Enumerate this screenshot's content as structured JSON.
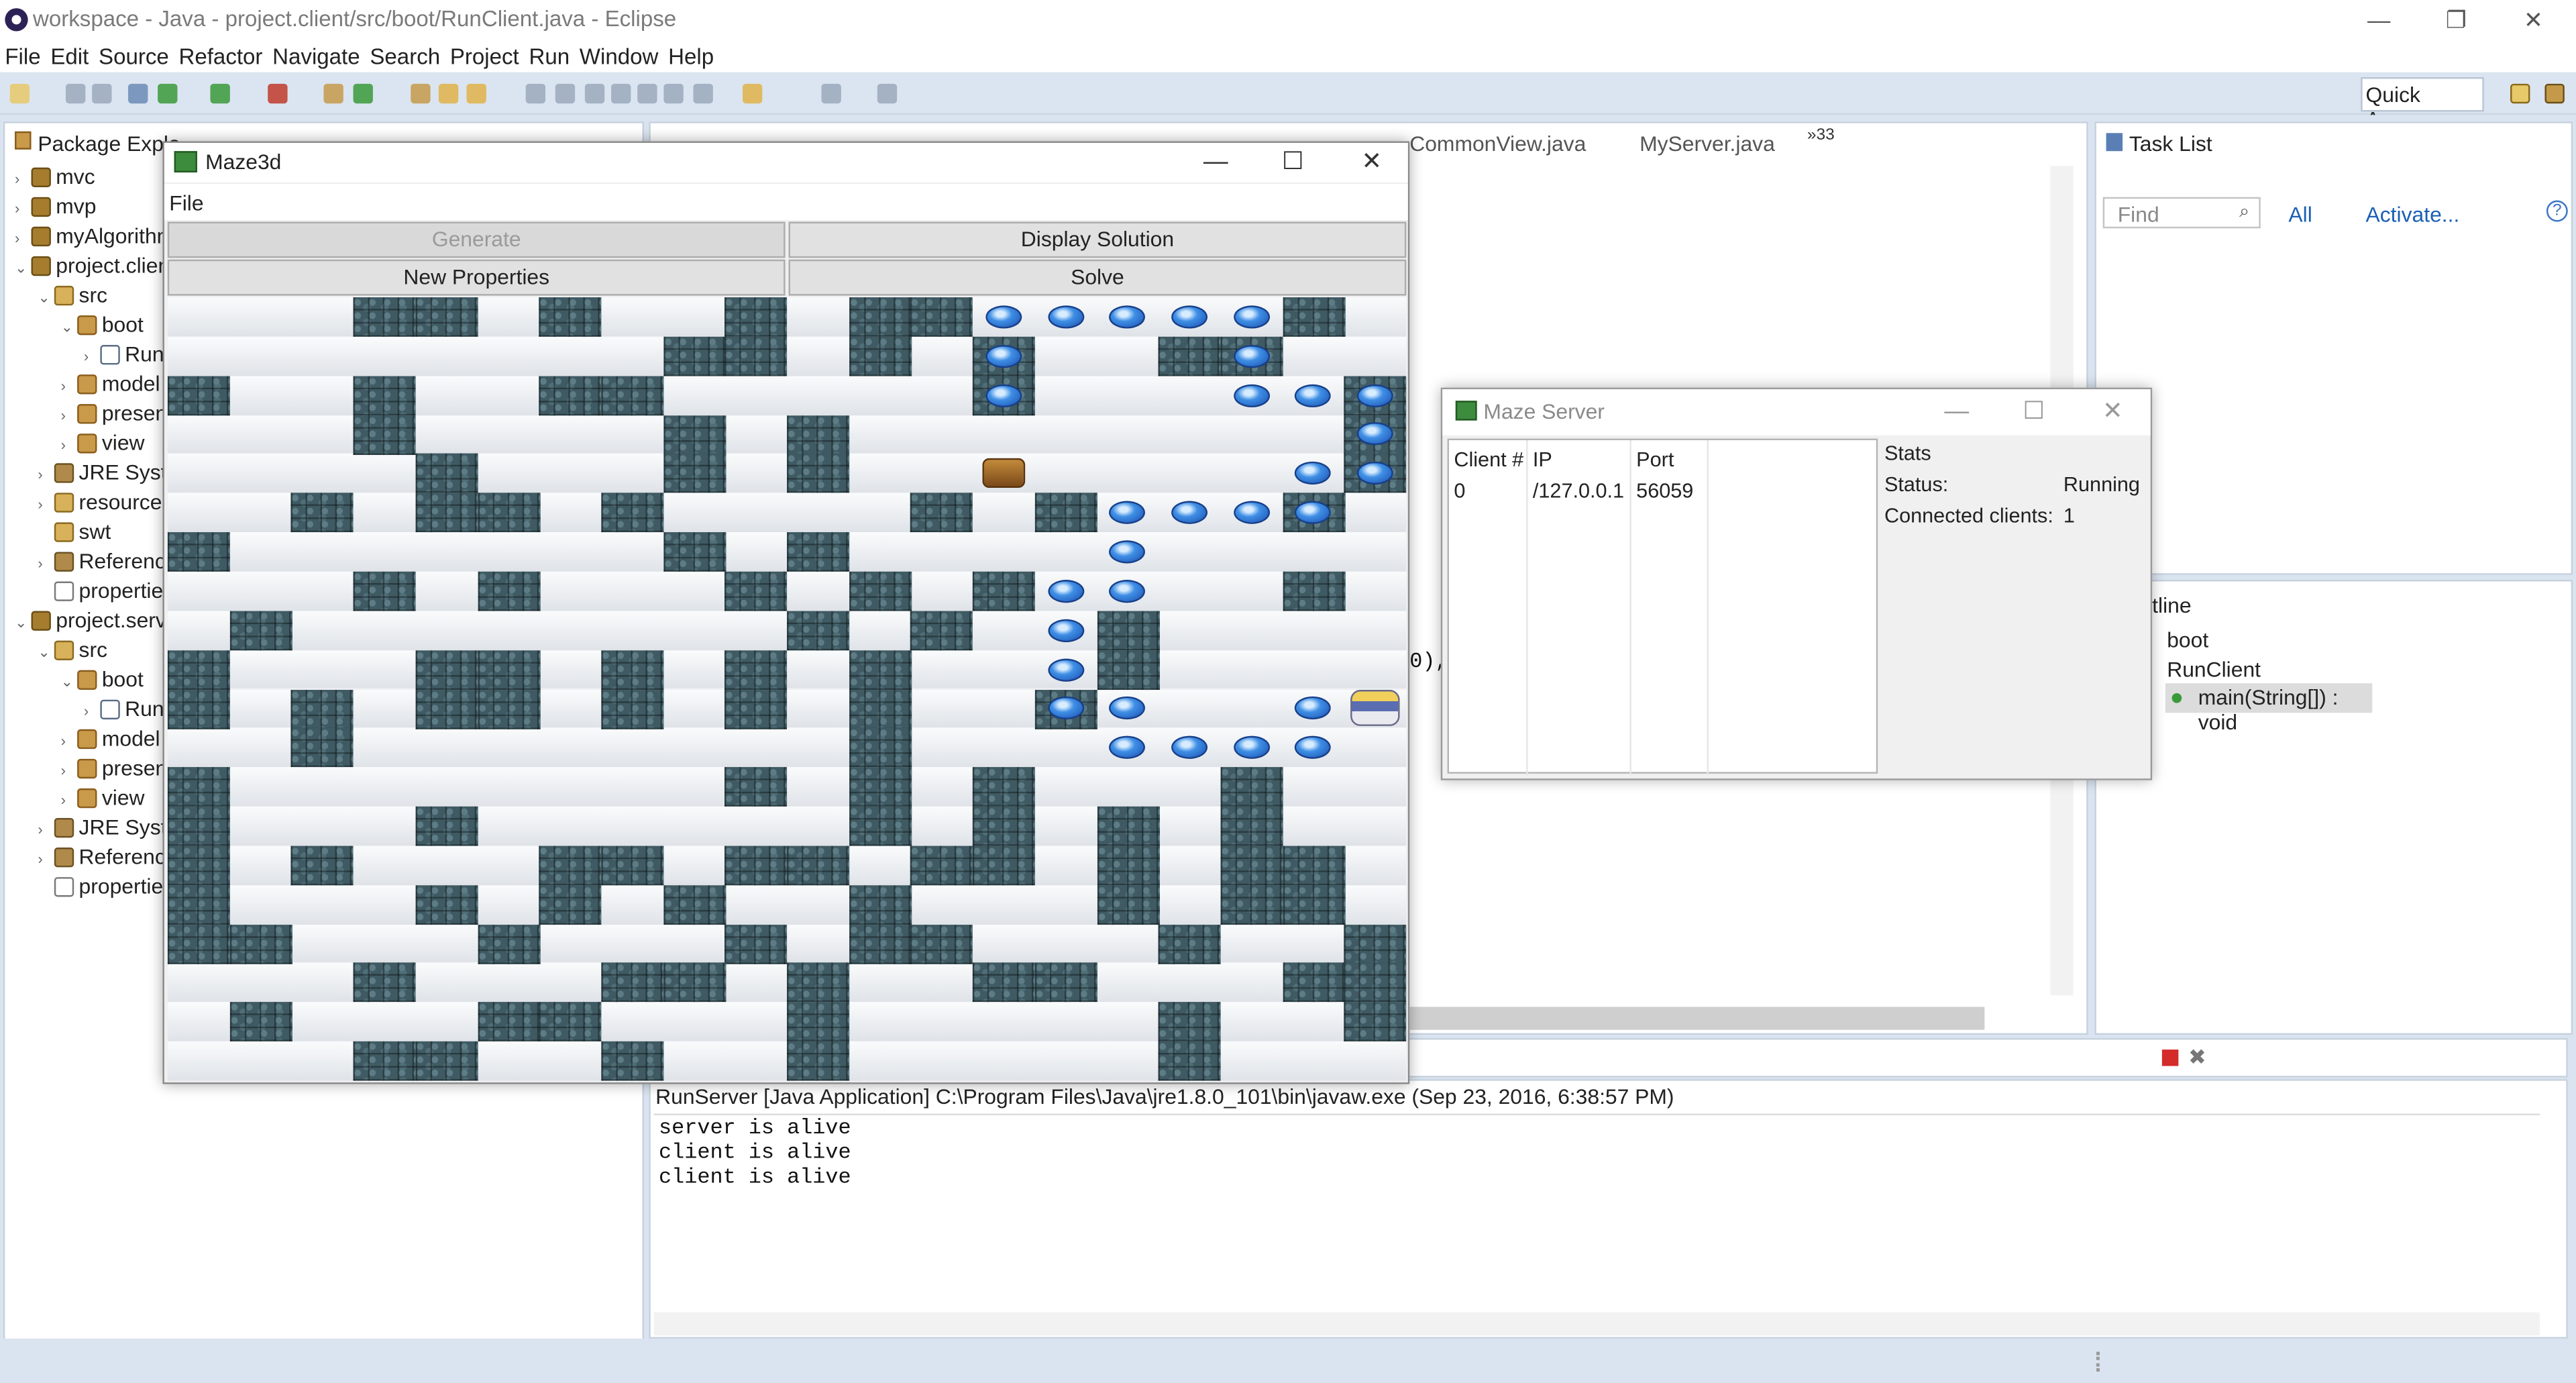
{
  "window": {
    "title": "workspace - Java - project.client/src/boot/RunClient.java - Eclipse",
    "minimize": "—",
    "restore": "❐",
    "close": "✕"
  },
  "menu": [
    "File",
    "Edit",
    "Source",
    "Refactor",
    "Navigate",
    "Search",
    "Project",
    "Run",
    "Window",
    "Help"
  ],
  "toolbar": {
    "quick_access": "Quick Access"
  },
  "package_explorer": {
    "tab": "Package Explo",
    "items": [
      {
        "label": "mvc",
        "icon": "project-icon",
        "indent": 0,
        "twisty": "›"
      },
      {
        "label": "mvp",
        "icon": "project-icon",
        "indent": 0,
        "twisty": "›"
      },
      {
        "label": "myAlgorithm",
        "icon": "project-icon",
        "indent": 0,
        "twisty": "›"
      },
      {
        "label": "project.client",
        "icon": "project-icon",
        "indent": 0,
        "twisty": "⌄"
      },
      {
        "label": "src",
        "icon": "source-folder-icon",
        "indent": 1,
        "twisty": "⌄"
      },
      {
        "label": "boot",
        "icon": "package-icon",
        "indent": 2,
        "twisty": "⌄"
      },
      {
        "label": "RunClient.java",
        "icon": "java-file-icon",
        "indent": 3,
        "twisty": "›"
      },
      {
        "label": "model",
        "icon": "package-icon",
        "indent": 2,
        "twisty": "›"
      },
      {
        "label": "presenter",
        "icon": "package-icon",
        "indent": 2,
        "twisty": "›"
      },
      {
        "label": "view",
        "icon": "package-icon",
        "indent": 2,
        "twisty": "›"
      },
      {
        "label": "JRE System Library",
        "icon": "library-icon",
        "indent": 1,
        "twisty": "›"
      },
      {
        "label": "resources",
        "icon": "source-folder-icon",
        "indent": 1,
        "twisty": "›"
      },
      {
        "label": "swt",
        "icon": "folder-icon",
        "indent": 1,
        "twisty": ""
      },
      {
        "label": "Referenced Libraries",
        "icon": "library-icon",
        "indent": 1,
        "twisty": "›"
      },
      {
        "label": "properties.xml",
        "icon": "xml-file-icon",
        "indent": 1,
        "twisty": ""
      },
      {
        "label": "project.server",
        "icon": "project-icon",
        "indent": 0,
        "twisty": "⌄"
      },
      {
        "label": "src",
        "icon": "source-folder-icon",
        "indent": 1,
        "twisty": "⌄"
      },
      {
        "label": "boot",
        "icon": "package-icon",
        "indent": 2,
        "twisty": "⌄"
      },
      {
        "label": "RunServer.java",
        "icon": "java-file-icon",
        "indent": 3,
        "twisty": "›"
      },
      {
        "label": "model",
        "icon": "package-icon",
        "indent": 2,
        "twisty": "›"
      },
      {
        "label": "presenter",
        "icon": "package-icon",
        "indent": 2,
        "twisty": "›"
      },
      {
        "label": "view",
        "icon": "package-icon",
        "indent": 2,
        "twisty": "›"
      },
      {
        "label": "JRE System Library",
        "icon": "library-icon",
        "indent": 1,
        "twisty": "›"
      },
      {
        "label": "Referenced Libraries",
        "icon": "library-icon",
        "indent": 1,
        "twisty": "›"
      },
      {
        "label": "properties.xml",
        "icon": "xml-file-icon",
        "indent": 1,
        "twisty": ""
      }
    ]
  },
  "editor": {
    "tabs": [
      "CommonView.java",
      "MyServer.java"
    ],
    "overflow": "»33",
    "code_fragment": "0),"
  },
  "task_list": {
    "tab": "Task List",
    "find_placeholder": "Find",
    "all": "All",
    "activate": "Activate..."
  },
  "outline": {
    "tab": "tline",
    "items": [
      {
        "label": "boot"
      },
      {
        "label": "RunClient"
      },
      {
        "label": "main(String[]) : void"
      }
    ]
  },
  "console": {
    "header": "RunServer [Java Application] C:\\Program Files\\Java\\jre1.8.0_101\\bin\\javaw.exe (Sep 23, 2016, 6:38:57 PM)",
    "lines": [
      "server is alive",
      "client is alive",
      "client is alive"
    ]
  },
  "maze_window": {
    "title": "Maze3d",
    "menu_file": "File",
    "buttons": {
      "generate": "Generate",
      "display_solution": "Display Solution",
      "new_properties": "New Properties",
      "solve": "Solve"
    },
    "grid_cols": 20,
    "grid_rows": 20,
    "walls": [
      "...##.#..#.##.....#.",
      "........##.#.#..##..",
      "#..#..##.....#.....#",
      "...#....#.#........#",
      "....#...#.#........#",
      "..#.##.#....#.#...#.",
      "#.......#.#.........",
      "...#.#...#.#.#....#.",
      ".#........#.#..#....",
      "#...##.#.#.#...#....",
      "#.#.##.#.#.#..#.....",
      "..#........#........",
      "#........#.#.#...#..",
      "#...#......#.#.#.#..",
      "#.#...##.##.##.#.##.",
      "#...#.#.#..#...#.##.",
      "##...#...#.##...#..#",
      "...#...##.#..##...##",
      ".#...##...#.....#..#",
      "...##..#..#.....#..."
    ],
    "solution_cells": [
      [
        0,
        13
      ],
      [
        0,
        14
      ],
      [
        0,
        15
      ],
      [
        0,
        16
      ],
      [
        0,
        17
      ],
      [
        1,
        13
      ],
      [
        1,
        17
      ],
      [
        2,
        13
      ],
      [
        2,
        17
      ],
      [
        2,
        18
      ],
      [
        2,
        19
      ],
      [
        3,
        19
      ],
      [
        4,
        18
      ],
      [
        4,
        19
      ],
      [
        5,
        15
      ],
      [
        5,
        16
      ],
      [
        5,
        17
      ],
      [
        5,
        18
      ],
      [
        6,
        15
      ],
      [
        7,
        14
      ],
      [
        7,
        15
      ],
      [
        8,
        14
      ],
      [
        9,
        14
      ],
      [
        10,
        14
      ],
      [
        10,
        15
      ],
      [
        10,
        18
      ],
      [
        11,
        15
      ],
      [
        11,
        16
      ],
      [
        11,
        17
      ],
      [
        11,
        18
      ]
    ],
    "start_cell": [
      4,
      13
    ],
    "goal_cell": [
      10,
      19
    ]
  },
  "server_window": {
    "title": "Maze Server",
    "columns": [
      "Client #",
      "IP",
      "Port"
    ],
    "rows": [
      [
        "0",
        "/127.0.0.1",
        "56059"
      ]
    ],
    "stats_title": "Stats",
    "status_label": "Status:",
    "status_value": "Running",
    "clients_label": "Connected clients:",
    "clients_value": "1"
  },
  "colors": {
    "toolbar": "#dbe5f1",
    "wall": "#3f5a63",
    "solution": "#3f8fe5"
  }
}
